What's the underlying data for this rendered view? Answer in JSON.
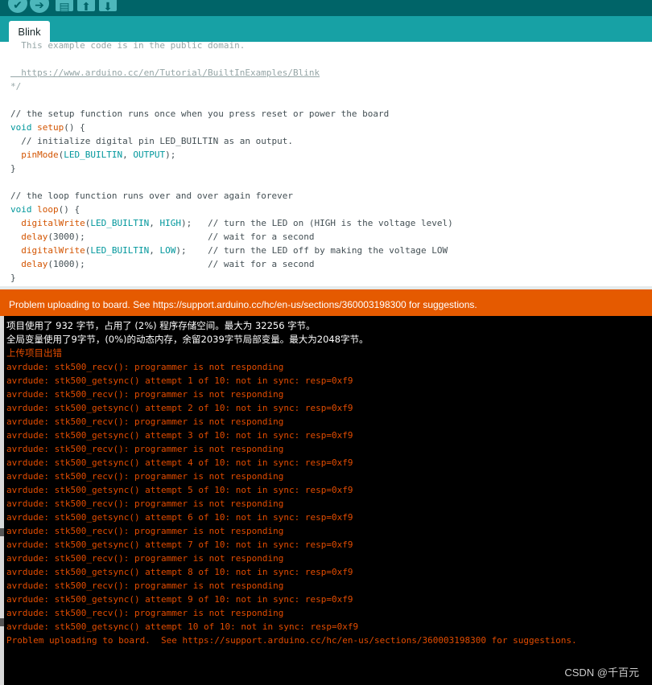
{
  "tab": {
    "label": "Blink"
  },
  "code": [
    {
      "cls": "c-comment",
      "text": "  This example code is in the public domain."
    },
    {
      "cls": "c-comment",
      "text": ""
    },
    {
      "cls": "c-link",
      "text": "  https://www.arduino.cc/en/Tutorial/BuiltInExamples/Blink"
    },
    {
      "cls": "c-comment",
      "text": "*/"
    },
    {
      "cls": "c-comment",
      "text": ""
    },
    {
      "cls": "c-dark",
      "text": "// the setup function runs once when you press reset or power the board"
    },
    {
      "cls": "c-dark",
      "text": "void setup() {"
    },
    {
      "cls": "c-dark",
      "text": "  // initialize digital pin LED_BUILTIN as an output."
    },
    {
      "cls": "c-dark",
      "text": "  pinMode(LED_BUILTIN, OUTPUT);"
    },
    {
      "cls": "c-dark",
      "text": "}"
    },
    {
      "cls": "c-dark",
      "text": ""
    },
    {
      "cls": "c-dark",
      "text": "// the loop function runs over and over again forever"
    },
    {
      "cls": "c-dark",
      "text": "void loop() {"
    },
    {
      "cls": "c-dark",
      "text": "  digitalWrite(LED_BUILTIN, HIGH);   // turn the LED on (HIGH is the voltage level)"
    },
    {
      "cls": "c-dark",
      "text": "  delay(3000);                       // wait for a second"
    },
    {
      "cls": "c-dark",
      "text": "  digitalWrite(LED_BUILTIN, LOW);    // turn the LED off by making the voltage LOW"
    },
    {
      "cls": "c-dark",
      "text": "  delay(1000);                       // wait for a second"
    },
    {
      "cls": "c-dark",
      "text": "}"
    }
  ],
  "status": {
    "message": "Problem uploading to board.  See https://support.arduino.cc/hc/en-us/sections/360003198300 for suggestions."
  },
  "console": [
    {
      "cls": "con-white",
      "text": "项目使用了 932 字节，占用了 (2%) 程序存储空间。最大为 32256 字节。"
    },
    {
      "cls": "con-white",
      "text": "全局变量使用了9字节，(0%)的动态内存，余留2039字节局部变量。最大为2048字节。"
    },
    {
      "cls": "con-red-cn",
      "text": "上传项目出错"
    },
    {
      "cls": "con-red",
      "text": "avrdude: stk500_recv(): programmer is not responding"
    },
    {
      "cls": "con-red",
      "text": "avrdude: stk500_getsync() attempt 1 of 10: not in sync: resp=0xf9"
    },
    {
      "cls": "con-red",
      "text": "avrdude: stk500_recv(): programmer is not responding"
    },
    {
      "cls": "con-red",
      "text": "avrdude: stk500_getsync() attempt 2 of 10: not in sync: resp=0xf9"
    },
    {
      "cls": "con-red",
      "text": "avrdude: stk500_recv(): programmer is not responding"
    },
    {
      "cls": "con-red",
      "text": "avrdude: stk500_getsync() attempt 3 of 10: not in sync: resp=0xf9"
    },
    {
      "cls": "con-red",
      "text": "avrdude: stk500_recv(): programmer is not responding"
    },
    {
      "cls": "con-red",
      "text": "avrdude: stk500_getsync() attempt 4 of 10: not in sync: resp=0xf9"
    },
    {
      "cls": "con-red",
      "text": "avrdude: stk500_recv(): programmer is not responding"
    },
    {
      "cls": "con-red",
      "text": "avrdude: stk500_getsync() attempt 5 of 10: not in sync: resp=0xf9"
    },
    {
      "cls": "con-red",
      "text": "avrdude: stk500_recv(): programmer is not responding"
    },
    {
      "cls": "con-red",
      "text": "avrdude: stk500_getsync() attempt 6 of 10: not in sync: resp=0xf9"
    },
    {
      "cls": "con-red",
      "text": "avrdude: stk500_recv(): programmer is not responding"
    },
    {
      "cls": "con-red",
      "text": "avrdude: stk500_getsync() attempt 7 of 10: not in sync: resp=0xf9"
    },
    {
      "cls": "con-red",
      "text": "avrdude: stk500_recv(): programmer is not responding"
    },
    {
      "cls": "con-red",
      "text": "avrdude: stk500_getsync() attempt 8 of 10: not in sync: resp=0xf9"
    },
    {
      "cls": "con-red",
      "text": "avrdude: stk500_recv(): programmer is not responding"
    },
    {
      "cls": "con-red",
      "text": "avrdude: stk500_getsync() attempt 9 of 10: not in sync: resp=0xf9"
    },
    {
      "cls": "con-red",
      "text": "avrdude: stk500_recv(): programmer is not responding"
    },
    {
      "cls": "con-red",
      "text": "avrdude: stk500_getsync() attempt 10 of 10: not in sync: resp=0xf9"
    },
    {
      "cls": "con-red",
      "text": "Problem uploading to board.  See https://support.arduino.cc/hc/en-us/sections/360003198300 for suggestions."
    }
  ],
  "watermark": "CSDN @千百元",
  "icons": {
    "verify": "checkmark-icon",
    "upload": "arrow-right-icon",
    "new": "new-file-icon",
    "open": "open-icon",
    "save": "save-icon"
  },
  "colors": {
    "toolbar": "#006468",
    "tabbar": "#17a1a5",
    "status": "#e55a00",
    "console_bg": "#000000",
    "console_error": "#e34c00"
  }
}
